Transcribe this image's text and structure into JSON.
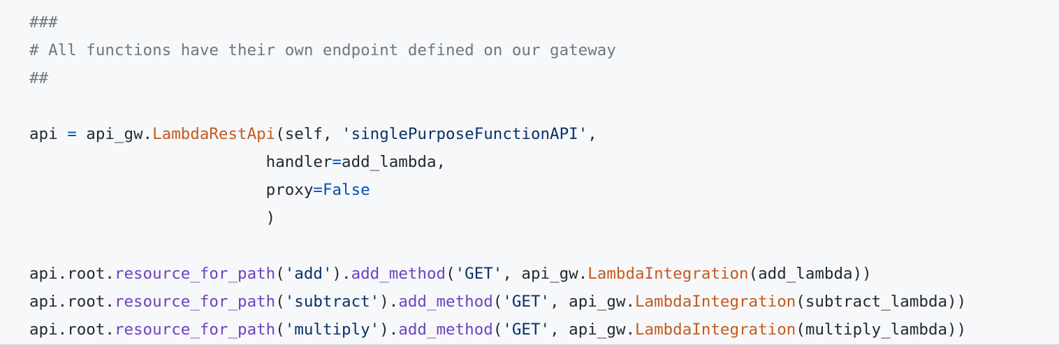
{
  "colors": {
    "background": "#f6f8fa",
    "comment": "#6e7781",
    "plain": "#24292f",
    "operator": "#0550ae",
    "function": "#c65a1e",
    "string": "#0a3069",
    "method": "#6f42c1"
  },
  "lines": [
    [
      {
        "t": "###",
        "k": "comment"
      }
    ],
    [
      {
        "t": "# All functions have their own endpoint defined on our gateway",
        "k": "comment"
      }
    ],
    [
      {
        "t": "##",
        "k": "comment"
      }
    ],
    [],
    [
      {
        "t": "api ",
        "k": "plain"
      },
      {
        "t": "=",
        "k": "op"
      },
      {
        "t": " api_gw.",
        "k": "plain"
      },
      {
        "t": "LambdaRestApi",
        "k": "func"
      },
      {
        "t": "(self, ",
        "k": "plain"
      },
      {
        "t": "'singlePurposeFunctionAPI'",
        "k": "str"
      },
      {
        "t": ",",
        "k": "plain"
      }
    ],
    [
      {
        "t": "                         handler",
        "k": "plain"
      },
      {
        "t": "=",
        "k": "op"
      },
      {
        "t": "add_lambda,",
        "k": "plain"
      }
    ],
    [
      {
        "t": "                         proxy",
        "k": "plain"
      },
      {
        "t": "=",
        "k": "op"
      },
      {
        "t": "False",
        "k": "const"
      }
    ],
    [
      {
        "t": "                         )",
        "k": "plain"
      }
    ],
    [],
    [
      {
        "t": "api.root.",
        "k": "plain"
      },
      {
        "t": "resource_for_path",
        "k": "method"
      },
      {
        "t": "(",
        "k": "plain"
      },
      {
        "t": "'add'",
        "k": "str"
      },
      {
        "t": ").",
        "k": "plain"
      },
      {
        "t": "add_method",
        "k": "method"
      },
      {
        "t": "(",
        "k": "plain"
      },
      {
        "t": "'GET'",
        "k": "str"
      },
      {
        "t": ", api_gw.",
        "k": "plain"
      },
      {
        "t": "LambdaIntegration",
        "k": "func"
      },
      {
        "t": "(add_lambda))",
        "k": "plain"
      }
    ],
    [
      {
        "t": "api.root.",
        "k": "plain"
      },
      {
        "t": "resource_for_path",
        "k": "method"
      },
      {
        "t": "(",
        "k": "plain"
      },
      {
        "t": "'subtract'",
        "k": "str"
      },
      {
        "t": ").",
        "k": "plain"
      },
      {
        "t": "add_method",
        "k": "method"
      },
      {
        "t": "(",
        "k": "plain"
      },
      {
        "t": "'GET'",
        "k": "str"
      },
      {
        "t": ", api_gw.",
        "k": "plain"
      },
      {
        "t": "LambdaIntegration",
        "k": "func"
      },
      {
        "t": "(subtract_lambda))",
        "k": "plain"
      }
    ],
    [
      {
        "t": "api.root.",
        "k": "plain"
      },
      {
        "t": "resource_for_path",
        "k": "method"
      },
      {
        "t": "(",
        "k": "plain"
      },
      {
        "t": "'multiply'",
        "k": "str"
      },
      {
        "t": ").",
        "k": "plain"
      },
      {
        "t": "add_method",
        "k": "method"
      },
      {
        "t": "(",
        "k": "plain"
      },
      {
        "t": "'GET'",
        "k": "str"
      },
      {
        "t": ", api_gw.",
        "k": "plain"
      },
      {
        "t": "LambdaIntegration",
        "k": "func"
      },
      {
        "t": "(multiply_lambda))",
        "k": "plain"
      }
    ]
  ]
}
